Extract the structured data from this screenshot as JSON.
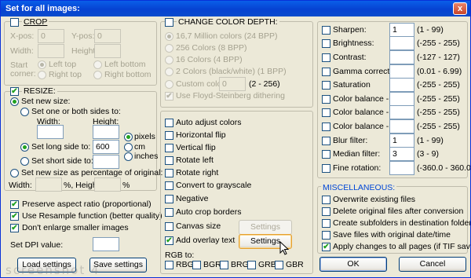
{
  "title": "Set for all images:",
  "close": "x",
  "crop": {
    "label": "CROP",
    "xpos": "X-pos:",
    "ypos": "Y-pos:",
    "xval": "0",
    "yval": "0",
    "width": "Width:",
    "height": "Height:",
    "start": "Start",
    "corner": "corner:",
    "lt": "Left top",
    "lb": "Left bottom",
    "rt": "Right top",
    "rb": "Right bottom"
  },
  "resize": {
    "label": "RESIZE:",
    "newsize": "Set new size:",
    "oneboth": "Set one or both sides to:",
    "w": "Width:",
    "h": "Height:",
    "long": "Set long side to:",
    "longval": "600",
    "short": "Set short side to:",
    "pixels": "pixels",
    "cm": "cm",
    "inches": "inches",
    "pct": "Set new size as percentage of original:",
    "pw": "Width:",
    "pctw": "%, Height:",
    "pcth": "%",
    "preserve": "Preserve aspect ratio (proportional)",
    "resample": "Use Resample function (better quality)",
    "noenlarge": "Don't enlarge smaller images",
    "dpi": "Set DPI value:"
  },
  "bottom": {
    "load": "Load settings",
    "save": "Save settings"
  },
  "depth": {
    "label": "CHANGE COLOR DEPTH:",
    "o1": "16,7 Million colors (24 BPP)",
    "o2": "256 Colors (8 BPP)",
    "o3": "16 Colors (4 BPP)",
    "o4": "2 Colors (black/white) (1 BPP)",
    "o5": "Custom colors:",
    "customval": "0",
    "range": "(2 - 256)",
    "dither": "Use Floyd-Steinberg dithering"
  },
  "ops": {
    "auto": "Auto adjust colors",
    "hflip": "Horizontal flip",
    "vflip": "Vertical flip",
    "rl": "Rotate left",
    "rr": "Rotate right",
    "gray": "Convert to grayscale",
    "neg": "Negative",
    "crop": "Auto crop borders",
    "canvas": "Canvas size",
    "overlay": "Add overlay text",
    "settings": "Settings",
    "rgbto": "RGB to:",
    "rgb": [
      "RBG",
      "BGR",
      "BRG",
      "GRB",
      "GBR"
    ]
  },
  "adjust": [
    {
      "label": "Sharpen:",
      "value": "1",
      "range": "(1 - 99)"
    },
    {
      "label": "Brightness:",
      "value": "",
      "range": "(-255 - 255)"
    },
    {
      "label": "Contrast:",
      "value": "",
      "range": "(-127 - 127)"
    },
    {
      "label": "Gamma correction:",
      "value": "",
      "range": "(0.01 - 6.99)"
    },
    {
      "label": "Saturation",
      "value": "",
      "range": "(-255 - 255)"
    },
    {
      "label": "Color balance - R:",
      "value": "",
      "range": "(-255 - 255)"
    },
    {
      "label": "Color balance - G:",
      "value": "",
      "range": "(-255 - 255)"
    },
    {
      "label": "Color balance - B:",
      "value": "",
      "range": "(-255 - 255)"
    },
    {
      "label": "Blur filter:",
      "value": "1",
      "range": "(1 - 99)"
    },
    {
      "label": "Median filter:",
      "value": "3",
      "range": "(3 - 9)"
    },
    {
      "label": "Fine rotation:",
      "value": "",
      "range": "(-360.0 - 360.0)"
    }
  ],
  "misc": {
    "label": "MISCELLANEOUS:",
    "o1": "Overwrite existing files",
    "o2": "Delete original files after conversion",
    "o3": "Create subfolders in destination folder",
    "o4": "Save files with original date/time",
    "o5": "Apply changes to all pages (if TIF saving)"
  },
  "ok": "OK",
  "cancel": "Cancel",
  "watermark": "screenshot 4"
}
